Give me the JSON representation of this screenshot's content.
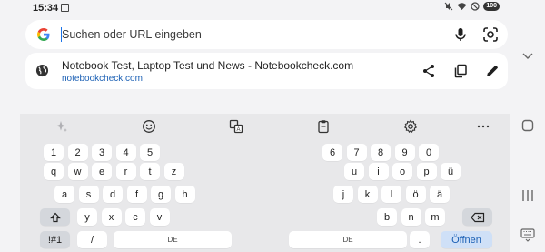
{
  "status": {
    "time": "15:34",
    "battery": "100"
  },
  "omnibox": {
    "placeholder": "Suchen oder URL eingeben",
    "value": ""
  },
  "suggestion": {
    "title": "Notebook Test, Laptop Test und News - Notebookcheck.com",
    "url": "notebookcheck.com"
  },
  "keyboard": {
    "left_rows": [
      [
        "1",
        "2",
        "3",
        "4",
        "5"
      ],
      [
        "q",
        "w",
        "e",
        "r",
        "t",
        "z"
      ],
      [
        "a",
        "s",
        "d",
        "f",
        "g",
        "h"
      ],
      [
        "y",
        "x",
        "c",
        "v"
      ]
    ],
    "right_rows": [
      [
        "6",
        "7",
        "8",
        "9",
        "0"
      ],
      [
        "u",
        "i",
        "o",
        "p",
        "ü"
      ],
      [
        "j",
        "k",
        "l",
        "ö",
        "ä"
      ],
      [
        "b",
        "n",
        "m"
      ]
    ],
    "symbols_label": "!#1",
    "slash_label": "/",
    "space_left_label": "DE",
    "space_right_label": "DE",
    "period_label": ".",
    "enter_label": "Öffnen"
  },
  "colors": {
    "accent": "#1a73e8",
    "enter_bg": "#cfe0f7",
    "keyboard_bg": "#e8e8ea"
  }
}
